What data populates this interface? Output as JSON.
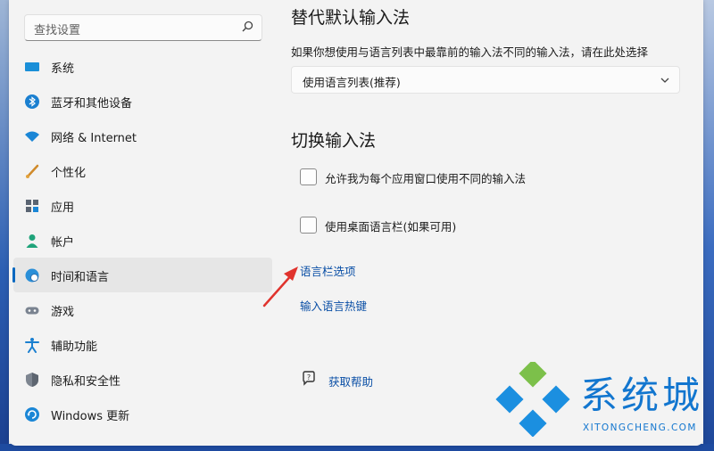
{
  "search": {
    "placeholder": "查找设置"
  },
  "sidebar": {
    "items": [
      {
        "label": "系统"
      },
      {
        "label": "蓝牙和其他设备"
      },
      {
        "label": "网络 & Internet"
      },
      {
        "label": "个性化"
      },
      {
        "label": "应用"
      },
      {
        "label": "帐户"
      },
      {
        "label": "时间和语言"
      },
      {
        "label": "游戏"
      },
      {
        "label": "辅助功能"
      },
      {
        "label": "隐私和安全性"
      },
      {
        "label": "Windows 更新"
      }
    ],
    "active_index": 6
  },
  "default_input": {
    "title": "替代默认输入法",
    "description": "如果你想使用与语言列表中最靠前的输入法不同的输入法，请在此处选择",
    "selected": "使用语言列表(推荐)"
  },
  "switch_input": {
    "title": "切换输入法",
    "option1": "允许我为每个应用窗口使用不同的输入法",
    "option2": "使用桌面语言栏(如果可用)",
    "link1": "语言栏选项",
    "link2": "输入语言热键"
  },
  "help": {
    "label": "获取帮助"
  },
  "watermark": {
    "text": "系统城",
    "sub": "XITONGCHENG.COM"
  },
  "colors": {
    "accent": "#0067c0",
    "link": "#0a4fa6",
    "arrow": "#e0332d",
    "watermark": "#1276cf"
  }
}
